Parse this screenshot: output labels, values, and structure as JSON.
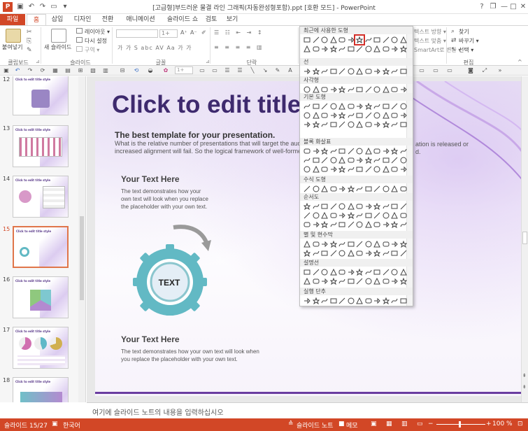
{
  "window": {
    "title": "[고급형]부드러운 물결 라인 그래픽(자동완성형포함).ppt [호환 모드] - PowerPoint",
    "app_icon": "P",
    "help": "?",
    "restore": "❐",
    "minimize": "—",
    "maximize": "□",
    "close": "✕"
  },
  "qat": [
    "save-icon",
    "undo-icon",
    "redo-icon",
    "start-from-beginning-icon",
    "customize-icon"
  ],
  "tabs": [
    "파일",
    "홈",
    "삽입",
    "디자인",
    "전환",
    "애니메이션",
    "슬라이드 쇼",
    "검토",
    "보기"
  ],
  "ribbon": {
    "clipboard": {
      "paste": "붙여넣기",
      "group": "클립보드"
    },
    "slides": {
      "new_slide": "새 슬라이드",
      "layout": "레이아웃 ▾",
      "reset": "다시 설정",
      "section": "구역 ▾",
      "group": "슬라이드"
    },
    "font": {
      "size": "1+",
      "group": "글꼴",
      "row2": "가  가  S  abc  AV  Aa  가  가"
    },
    "paragraph": {
      "group": "단락"
    },
    "drawing": {
      "text_dir": "텍스트 방향 ▾",
      "align_text": "텍스트 맞춤 ▾",
      "smartart": "SmartArt로 변환 ▾",
      "fill": "도형 채우기 ▾",
      "outline": "도형 윤곽선 ▾",
      "effects": "도형 효과 ▾"
    },
    "editing": {
      "find": "찾기",
      "replace": "바꾸기 ▾",
      "select": "선택 ▾",
      "group": "편집"
    }
  },
  "thumbnails": [
    {
      "num": "12",
      "title": "Click to edit title style"
    },
    {
      "num": "13",
      "title": "Click to edit title style"
    },
    {
      "num": "14",
      "title": "Click to edit title style"
    },
    {
      "num": "15",
      "title": "Click to edit title style",
      "selected": true
    },
    {
      "num": "16",
      "title": "Click to edit title style"
    },
    {
      "num": "17",
      "title": "Click to edit title style"
    },
    {
      "num": "18",
      "title": "Click to edit title style"
    }
  ],
  "slide": {
    "title": "Click to edit title s",
    "subtitle": "The best template for your presentation.",
    "body_line1": "What is the relative number of presentations that will target the audienc",
    "body_line2": "increased alignment will fail. So the logical framework of well-formed, it i",
    "body_right1": "ation is released or",
    "body_right2": "d.",
    "block1_title": "Your Text Here",
    "block1_text": [
      "The text demonstrates how your",
      "own text will look when you replace",
      "the placeholder with your own text."
    ],
    "gear_label": "TEXT",
    "block2_title": "Your Text Here",
    "block2_text": [
      "The text demonstrates how your own text will look when",
      "you replace the placeholder with your own text."
    ]
  },
  "notes_placeholder": "여기에 슬라이드 노트의 내용을 입력하십시오",
  "status": {
    "slide": "슬라이드 15/27",
    "lang": "한국어",
    "notes": "슬라이드 노트",
    "comments": "메모",
    "zoom": "100 %"
  },
  "shapes_panel": {
    "sections": [
      "최근에 사용한 도형",
      "선",
      "사각형",
      "기본 도형",
      "블록 화살표",
      "수식 도형",
      "순서도",
      "별 및 현수막",
      "설명선",
      "실행 단추"
    ]
  },
  "colors": {
    "accent": "#d24726",
    "slide_title": "#3e2a6e",
    "gear": "#62b9c4",
    "purple_line": "#6a3da0"
  }
}
